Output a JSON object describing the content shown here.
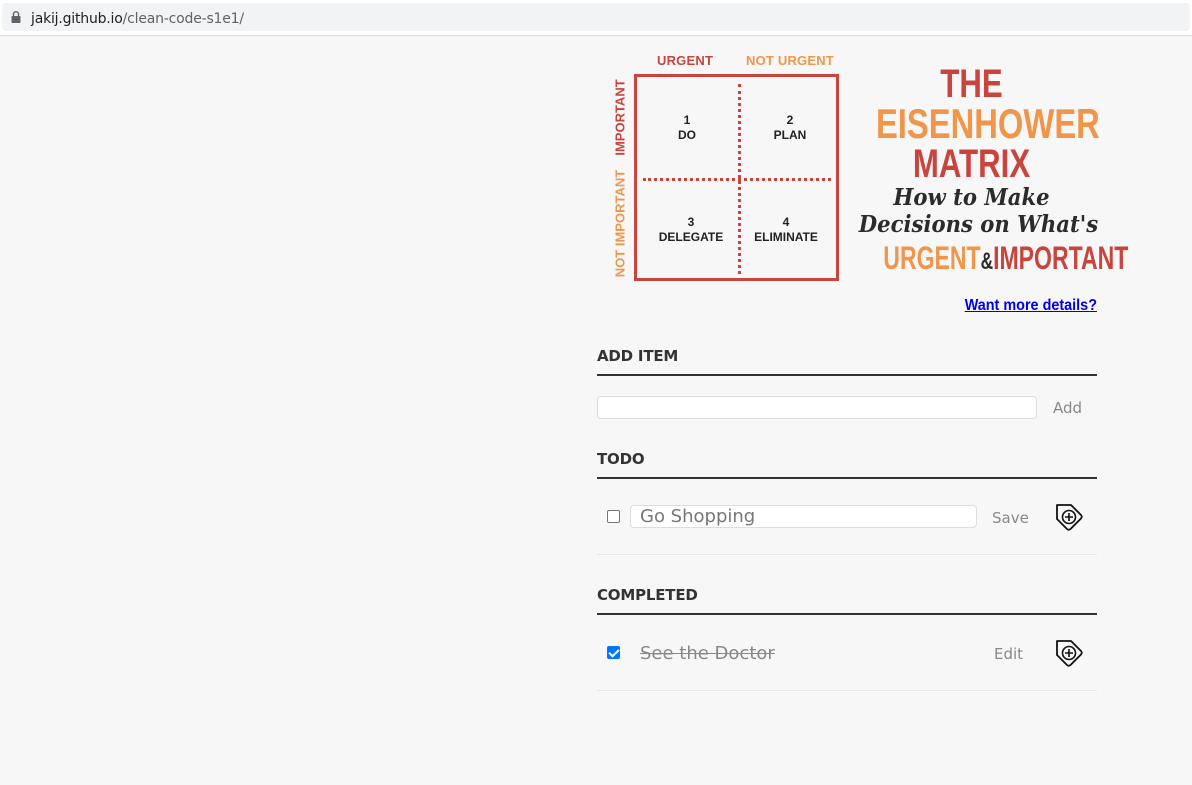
{
  "browser": {
    "url_host": "jakij.github.io",
    "url_path": "/clean-code-s1e1/"
  },
  "matrix": {
    "col_urgent": "URGENT",
    "col_not_urgent": "NOT URGENT",
    "row_important": "IMPORTANT",
    "row_not_important": "NOT IMPORTANT",
    "cells": [
      {
        "num": "1",
        "label": "DO"
      },
      {
        "num": "2",
        "label": "PLAN"
      },
      {
        "num": "3",
        "label": "DELEGATE"
      },
      {
        "num": "4",
        "label": "ELIMINATE"
      }
    ],
    "title_1": "THE",
    "title_2": "EISENHOWER",
    "title_3": "MATRIX",
    "subtitle_1": "How to Make",
    "subtitle_2": "Decisions on What's",
    "bottom_urgent": "URGENT",
    "bottom_amp": "&",
    "bottom_important": "IMPORTANT",
    "colors": {
      "red": "#c8443d",
      "orange": "#f0964b"
    }
  },
  "details_link": "Want more details?",
  "add_section": {
    "title": "ADD ITEM",
    "input_value": "",
    "add_label": "Add"
  },
  "todo_section": {
    "title": "TODO",
    "items": [
      {
        "text": "Go Shopping",
        "checked": false,
        "action_label": "Save",
        "delete_icon": "tag-plus-icon"
      }
    ]
  },
  "completed_section": {
    "title": "COMPLETED",
    "items": [
      {
        "text": "See the Doctor",
        "checked": true,
        "action_label": "Edit",
        "delete_icon": "tag-plus-icon"
      }
    ]
  }
}
